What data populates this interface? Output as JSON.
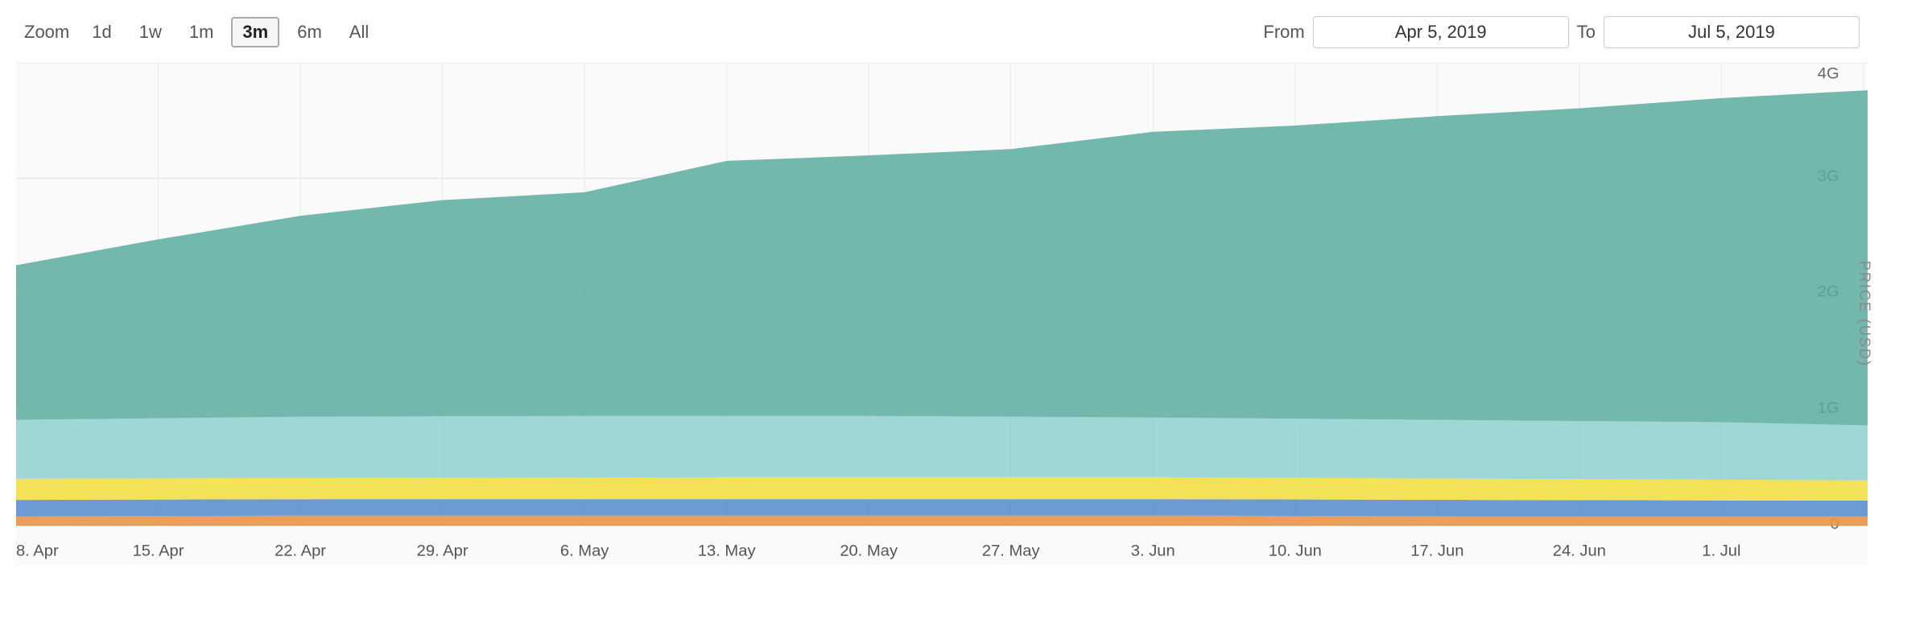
{
  "toolbar": {
    "zoom_label": "Zoom",
    "zoom_buttons": [
      {
        "label": "1d",
        "active": false
      },
      {
        "label": "1w",
        "active": false
      },
      {
        "label": "1m",
        "active": false
      },
      {
        "label": "3m",
        "active": true
      },
      {
        "label": "6m",
        "active": false
      },
      {
        "label": "All",
        "active": false
      }
    ],
    "from_label": "From",
    "to_label": "To",
    "from_date": "Apr 5, 2019",
    "to_date": "Jul 5, 2019"
  },
  "y_axis": {
    "label": "PRICE (USD)",
    "ticks": [
      "0",
      "1G",
      "2G",
      "3G",
      "4G"
    ]
  },
  "x_axis": {
    "labels": [
      "8. Apr",
      "15. Apr",
      "22. Apr",
      "29. Apr",
      "6. May",
      "13. May",
      "20. May",
      "27. May",
      "3. Jun",
      "10. Jun",
      "17. Jun",
      "24. Jun",
      "1. Jul"
    ]
  },
  "colors": {
    "green": "#5aab9e",
    "light_blue": "#8ecfcf",
    "yellow": "#f2e04e",
    "blue": "#5b8fcf",
    "orange": "#e8944a",
    "dark_green": "#3d9b8a",
    "grid_line": "#e8e8e8",
    "background": "#fafafa"
  }
}
